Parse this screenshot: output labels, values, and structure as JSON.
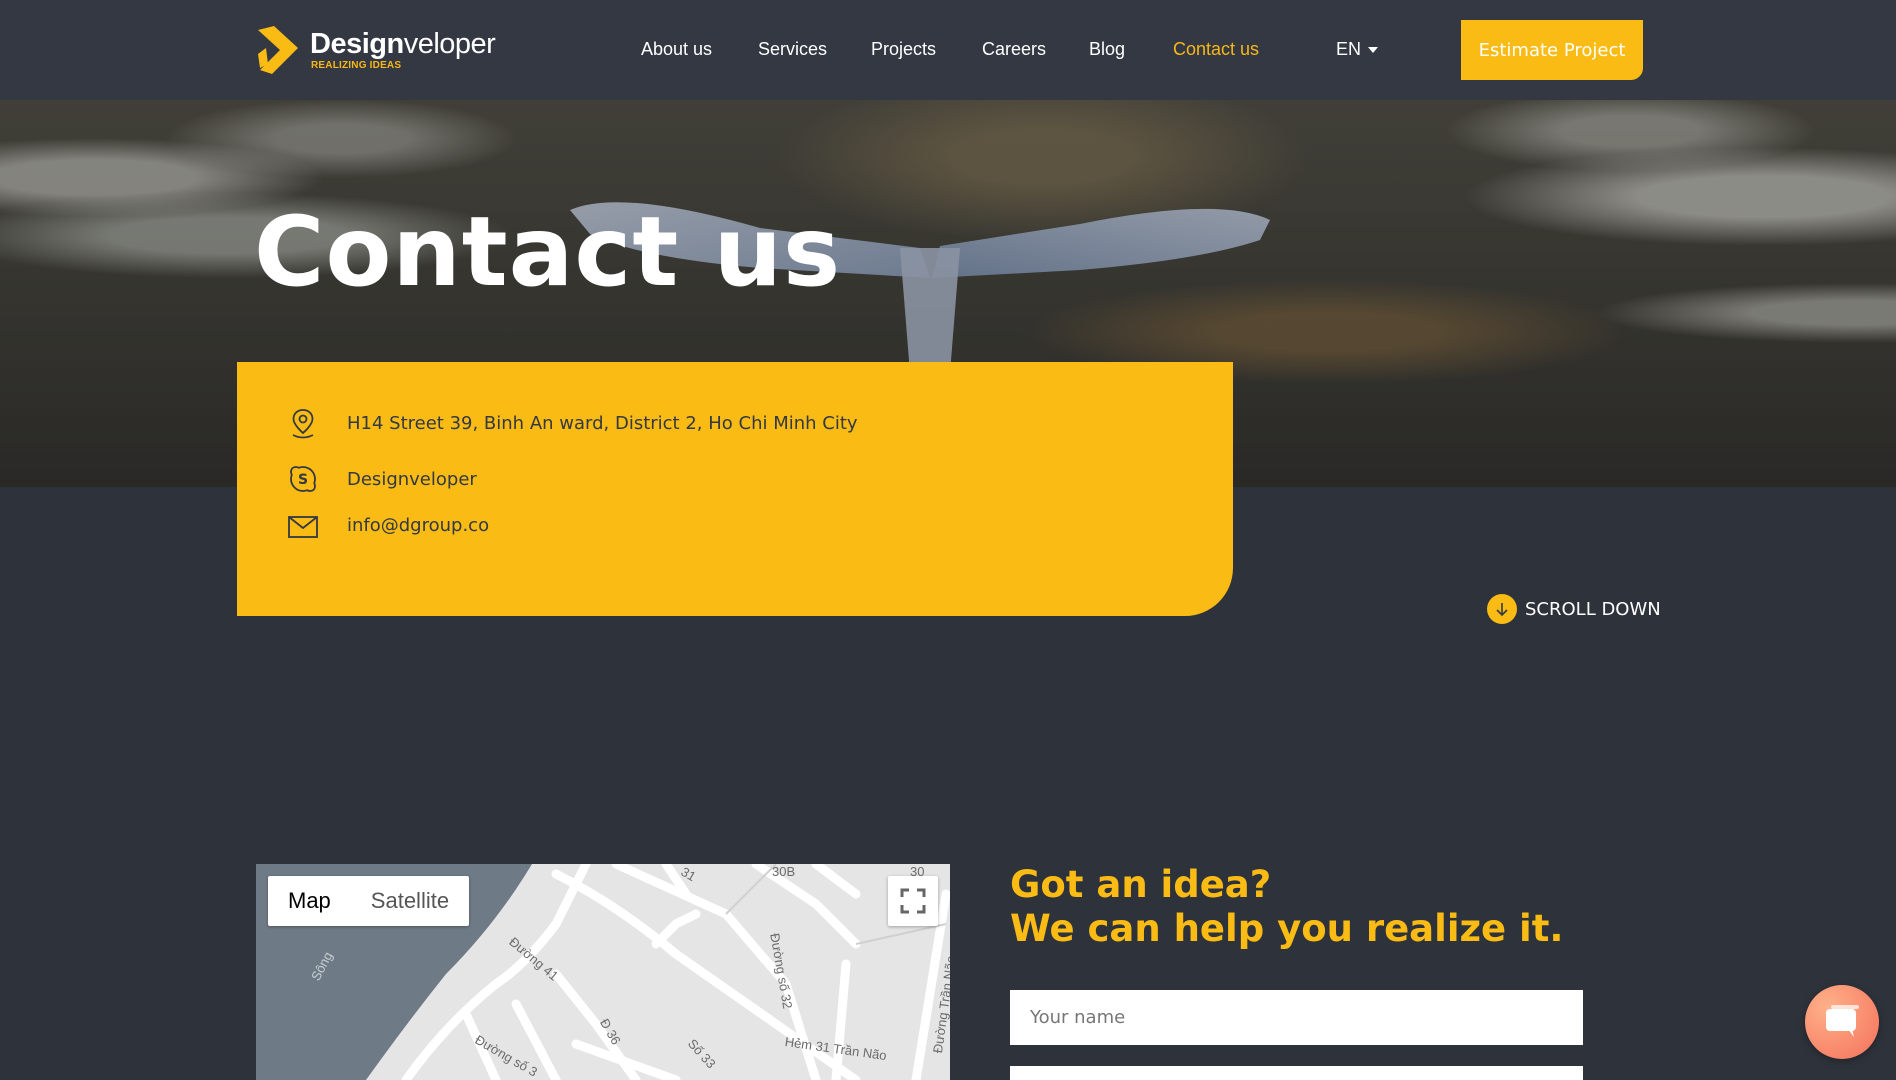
{
  "brand": {
    "name_bold": "Design",
    "name_rest": "veloper",
    "tagline": "REALIZING IDEAS",
    "accent_color": "#f9bb14"
  },
  "nav": {
    "items": [
      {
        "label": "About us",
        "active": false
      },
      {
        "label": "Services",
        "active": false
      },
      {
        "label": "Projects",
        "active": false
      },
      {
        "label": "Careers",
        "active": false
      },
      {
        "label": "Blog",
        "active": false
      },
      {
        "label": "Contact us",
        "active": true
      }
    ],
    "language": "EN",
    "cta_label": "Estimate Project"
  },
  "hero": {
    "title": "Contact us"
  },
  "contact": {
    "address": "H14 Street 39, Binh An ward, District 2, Ho Chi Minh City",
    "skype": "Designveloper",
    "email": "info@dgroup.co",
    "icons": [
      "location-pin-icon",
      "skype-icon",
      "mail-icon"
    ]
  },
  "scroll": {
    "label": "SCROLL DOWN"
  },
  "map": {
    "tab_map": "Map",
    "tab_satellite": "Satellite",
    "selected_tab": "Map",
    "street_labels": [
      "Sông",
      "Đường 41",
      "Đường số 32",
      "Đ 36",
      "Số 33",
      "Hẻm 31 Trần Não",
      "Đường Trần Não",
      "Đường số 3",
      "30B",
      "31",
      "30"
    ]
  },
  "form": {
    "heading_line1": "Got an idea?",
    "heading_line2": "We can help you realize it.",
    "name_placeholder": "Your name"
  }
}
